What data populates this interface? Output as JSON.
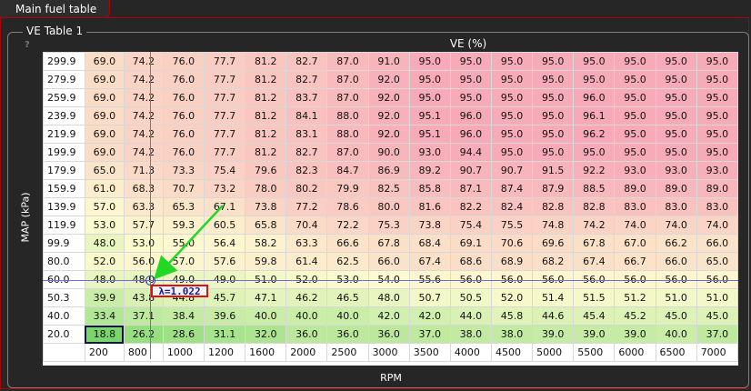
{
  "window": {
    "tab_title": "Main fuel table"
  },
  "group": {
    "title": "VE Table 1",
    "help": "?"
  },
  "axes": {
    "z_label": "VE (%)",
    "x_label": "RPM",
    "y_label": "MAP (kPa)"
  },
  "rpm": [
    "200",
    "800",
    "1000",
    "1200",
    "1600",
    "2000",
    "2500",
    "3000",
    "3500",
    "4000",
    "4500",
    "5000",
    "5500",
    "6000",
    "6500",
    "7000"
  ],
  "map": [
    "299.9",
    "279.9",
    "259.9",
    "239.9",
    "219.9",
    "199.9",
    "179.9",
    "159.9",
    "139.9",
    "119.9",
    "99.9",
    "80.0",
    "60.0",
    "50.3",
    "40.0",
    "20.0"
  ],
  "values": [
    [
      "69.0",
      "74.2",
      "76.0",
      "77.7",
      "81.2",
      "82.7",
      "87.0",
      "91.0",
      "95.0",
      "95.0",
      "95.0",
      "95.0",
      "95.0",
      "95.0",
      "95.0",
      "95.0"
    ],
    [
      "69.0",
      "74.2",
      "76.0",
      "77.7",
      "81.2",
      "82.7",
      "87.0",
      "92.0",
      "95.0",
      "95.0",
      "95.0",
      "95.0",
      "95.0",
      "95.0",
      "95.0",
      "95.0"
    ],
    [
      "69.0",
      "74.2",
      "76.0",
      "77.7",
      "81.2",
      "83.7",
      "87.0",
      "92.0",
      "95.0",
      "95.0",
      "95.0",
      "95.0",
      "96.0",
      "95.0",
      "95.0",
      "95.0"
    ],
    [
      "69.0",
      "74.2",
      "76.0",
      "77.7",
      "81.2",
      "84.1",
      "88.0",
      "92.0",
      "95.1",
      "96.0",
      "95.0",
      "95.0",
      "96.1",
      "95.0",
      "95.0",
      "95.0"
    ],
    [
      "69.0",
      "74.2",
      "76.0",
      "77.7",
      "81.2",
      "83.1",
      "88.0",
      "92.0",
      "95.1",
      "96.0",
      "95.0",
      "95.0",
      "96.2",
      "95.0",
      "95.0",
      "95.0"
    ],
    [
      "69.0",
      "74.2",
      "76.0",
      "77.7",
      "81.2",
      "82.7",
      "87.0",
      "90.0",
      "93.0",
      "94.4",
      "95.0",
      "95.0",
      "95.0",
      "95.0",
      "95.0",
      "95.0"
    ],
    [
      "65.0",
      "71.3",
      "73.3",
      "75.4",
      "79.6",
      "82.3",
      "84.7",
      "86.9",
      "89.2",
      "90.7",
      "90.7",
      "91.5",
      "92.2",
      "93.0",
      "93.0",
      "93.0"
    ],
    [
      "61.0",
      "68.3",
      "70.7",
      "73.2",
      "78.0",
      "80.2",
      "79.9",
      "82.5",
      "85.8",
      "87.1",
      "87.4",
      "87.9",
      "88.5",
      "89.0",
      "89.0",
      "89.0"
    ],
    [
      "57.0",
      "63.3",
      "65.3",
      "67.1",
      "73.8",
      "77.2",
      "78.6",
      "80.0",
      "81.6",
      "82.2",
      "82.4",
      "82.8",
      "82.8",
      "83.0",
      "83.0",
      "83.0"
    ],
    [
      "53.0",
      "57.7",
      "59.3",
      "60.5",
      "65.8",
      "70.4",
      "72.2",
      "75.3",
      "73.8",
      "75.4",
      "75.5",
      "74.8",
      "74.2",
      "74.0",
      "74.0",
      "74.0"
    ],
    [
      "48.0",
      "53.0",
      "55.0",
      "56.4",
      "58.2",
      "63.3",
      "66.6",
      "67.8",
      "68.4",
      "69.1",
      "70.6",
      "69.6",
      "67.8",
      "67.0",
      "66.2",
      "66.0"
    ],
    [
      "52.0",
      "56.0",
      "57.0",
      "57.6",
      "59.8",
      "61.4",
      "62.5",
      "66.0",
      "67.4",
      "68.6",
      "68.9",
      "68.2",
      "67.4",
      "66.7",
      "66.0",
      "65.0"
    ],
    [
      "48.0",
      "48.0",
      "49.0",
      "49.0",
      "51.0",
      "52.0",
      "53.0",
      "54.0",
      "55.6",
      "56.0",
      "56.0",
      "56.0",
      "56.0",
      "56.0",
      "56.0",
      "56.0"
    ],
    [
      "39.9",
      "43.8",
      "44.8",
      "45.7",
      "47.1",
      "46.2",
      "46.5",
      "48.0",
      "50.7",
      "50.5",
      "52.0",
      "51.4",
      "51.5",
      "51.2",
      "51.0",
      "51.0"
    ],
    [
      "33.4",
      "37.1",
      "38.4",
      "39.6",
      "40.0",
      "40.0",
      "40.0",
      "42.0",
      "42.0",
      "44.0",
      "45.8",
      "44.6",
      "45.4",
      "45.2",
      "45.0",
      "45.0"
    ],
    [
      "18.8",
      "26.2",
      "28.6",
      "31.1",
      "32.0",
      "36.0",
      "36.0",
      "36.0",
      "37.0",
      "38.0",
      "38.0",
      "39.0",
      "39.0",
      "39.0",
      "40.0",
      "37.0"
    ]
  ],
  "selected_cell": {
    "row": 15,
    "col": 0
  },
  "live_point": {
    "map": "60.0",
    "rpm": "800",
    "lambda_text": "λ=1.022"
  },
  "colors": {
    "low": "#7ad66a",
    "mid": "#fdfbd0",
    "high": "#f7a9b8",
    "marker_box": "#e01010",
    "arrow": "#22d822",
    "crosshair": "#6e6ed8"
  }
}
